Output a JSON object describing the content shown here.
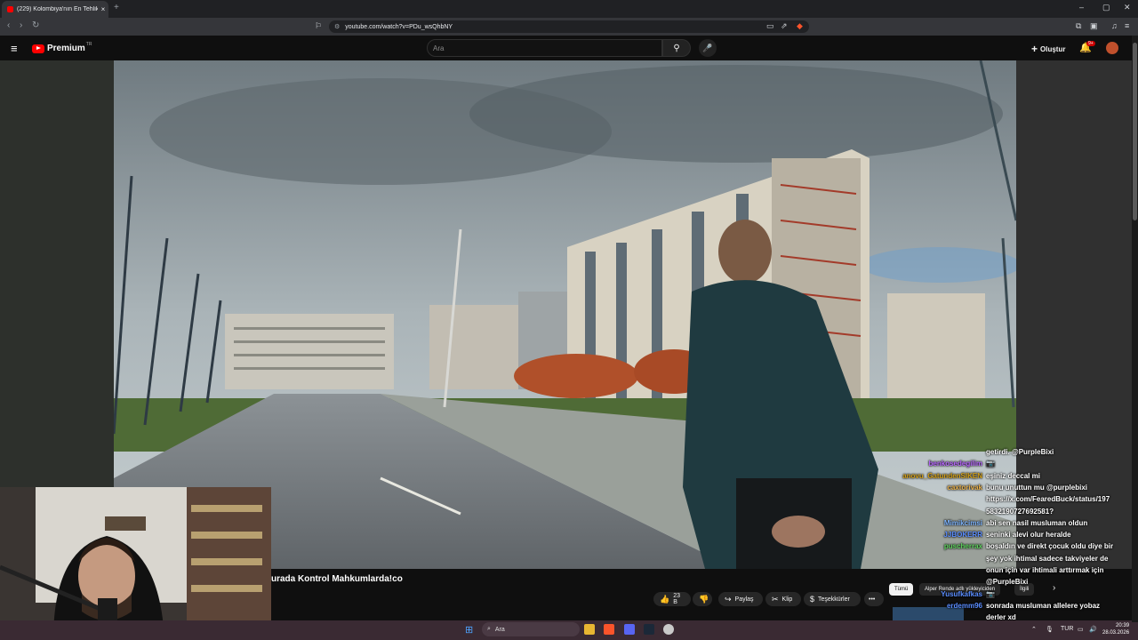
{
  "browser": {
    "tab_title": "(229) Kolombiya'nın En Tehlikeli",
    "tab_close": "×",
    "new_tab": "+",
    "url": "youtube.com/watch?v=PDu_wsQhbNY",
    "window_controls": [
      "–",
      "▢",
      "✕"
    ]
  },
  "youtube": {
    "logo_text": "Premium",
    "logo_country": "TR",
    "search_placeholder": "Ara",
    "create_label": "Oluştur",
    "notification_count": "9+"
  },
  "video": {
    "title": "urada Kontrol Mahkumlarda!co",
    "actions": {
      "like_count": "23 B",
      "share": "Paylaş",
      "clip": "Klip",
      "thanks": "Teşekkürler",
      "more": "•••"
    }
  },
  "chips": [
    "Tümü",
    "Alper Rende adlı yükleyiciden",
    "İlgili"
  ],
  "chat": {
    "messages": [
      {
        "user": "",
        "text": "getirdi. @PurpleBixi",
        "user_color": "#ffffff"
      },
      {
        "user": "benkosedegilim",
        "text": "📷",
        "user_color": "#b866ff"
      },
      {
        "user": "anovu_GatundenSIKEN",
        "text": "eşiniz deccal mi",
        "user_color": "#d4a017"
      },
      {
        "user": "caxtorivak",
        "text": "bunu unuttun mu @purplebixi",
        "user_color": "#e8b04a"
      },
      {
        "user": "",
        "text": "https://x.com/FearedBuck/status/197",
        "user_color": "#ffffff"
      },
      {
        "user": "",
        "text": "5832190727692581?",
        "user_color": "#ffffff"
      },
      {
        "user": "Mimikcimsi",
        "text": "abi sen nasil musluman oldun",
        "user_color": "#7fb6ff"
      },
      {
        "user": "JJBOKERR",
        "text": "seninki alevi olur heralde",
        "user_color": "#5a8dff"
      },
      {
        "user": "puscherrax",
        "text": "boşaldın ve direkt çocuk oldu diye bir",
        "user_color": "#5ed35e"
      },
      {
        "user": "",
        "text": "şey yok ihtimal sadece takviyeler de",
        "user_color": "#ffffff"
      },
      {
        "user": "",
        "text": "onun için var ihtimali arttırmak için",
        "user_color": "#ffffff"
      },
      {
        "user": "",
        "text": "@PurpleBixi",
        "user_color": "#ffffff"
      },
      {
        "user": "Yusufkafkas",
        "text": "📷",
        "user_color": "#5a8dff"
      },
      {
        "user": "erdemm96",
        "text": "sonrada musluman allelere yobaz",
        "user_color": "#5a8dff"
      },
      {
        "user": "",
        "text": "derler xd",
        "user_color": "#ffffff"
      },
      {
        "user": "benkosedegilim",
        "text": "📷",
        "user_color": "#b866ff"
      }
    ]
  },
  "taskbar": {
    "search": "Ara",
    "language": "TUR",
    "time": "20:39",
    "date": "28.03.2026"
  },
  "colors": {
    "yt_red": "#ff0000",
    "taskbar": "#3a2a33",
    "chip_active": "#f1f1f1"
  }
}
